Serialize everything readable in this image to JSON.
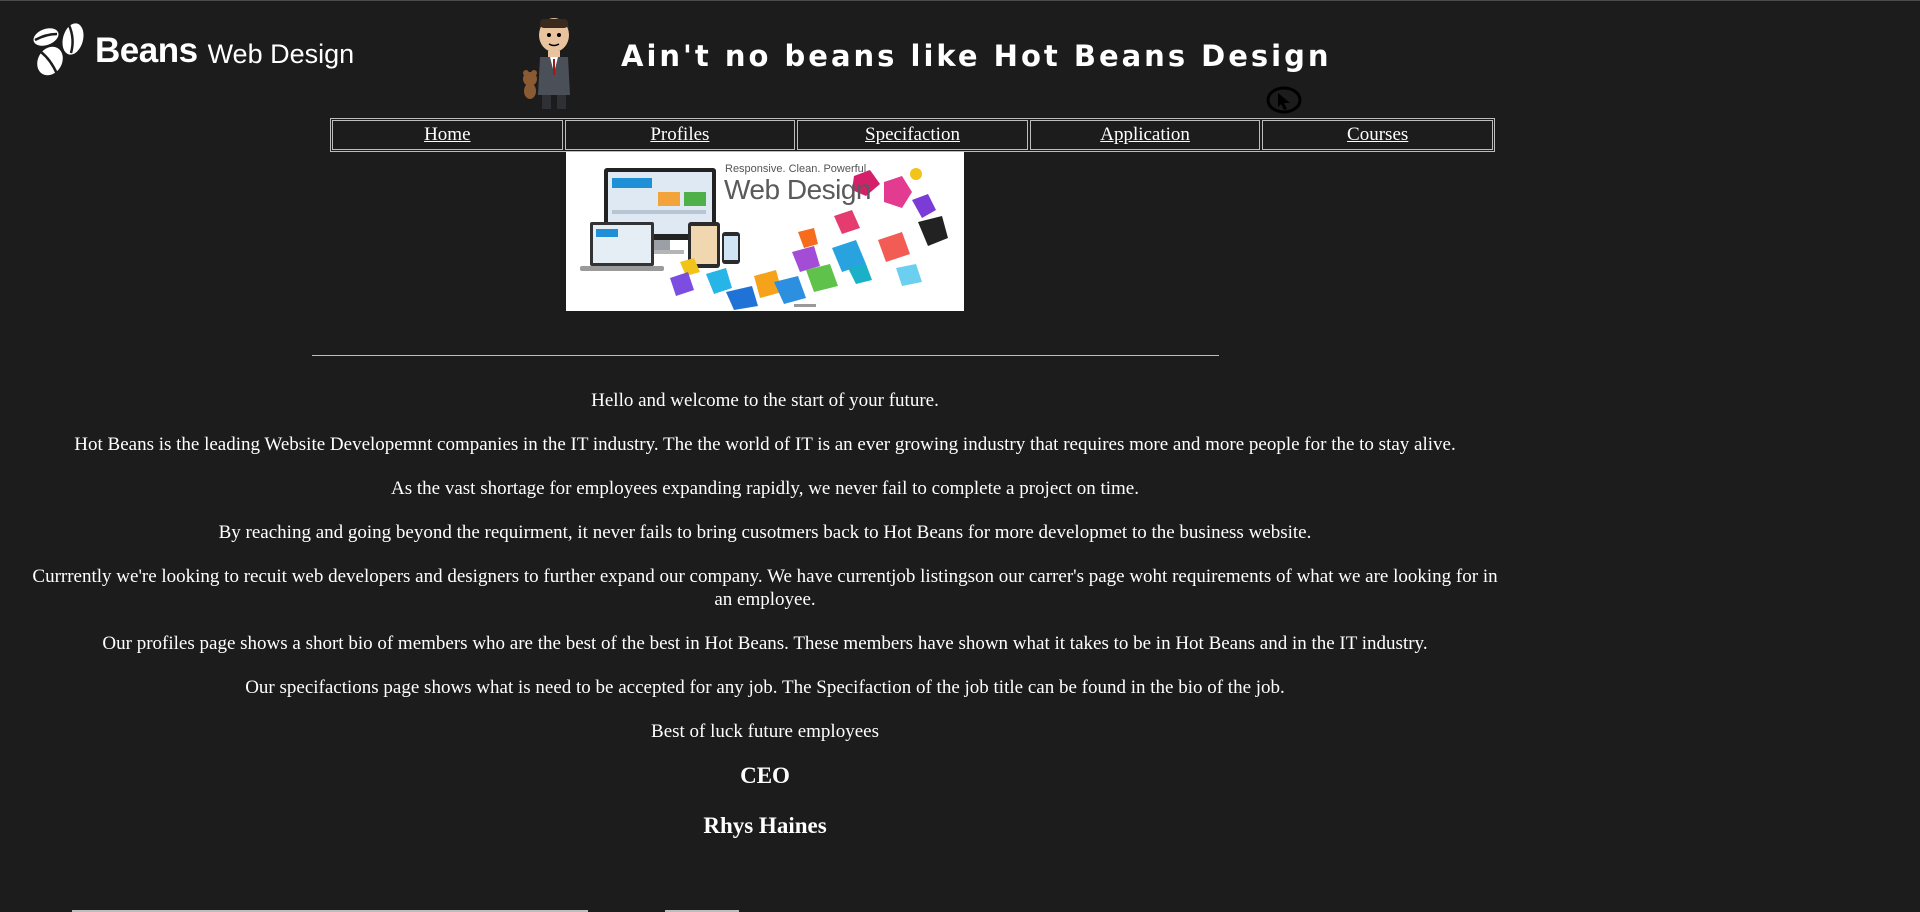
{
  "header": {
    "logo_bold": "Beans",
    "logo_light": "Web Design",
    "tagline": "Ain't no beans like Hot Beans Design"
  },
  "nav": {
    "items": [
      {
        "label": "Home"
      },
      {
        "label": "Profiles"
      },
      {
        "label": "Specifaction"
      },
      {
        "label": "Application"
      },
      {
        "label": "Courses"
      }
    ]
  },
  "banner": {
    "small_text": "Responsive. Clean. Powerful.",
    "big_text": "Web Design"
  },
  "main": {
    "paragraphs": [
      "Hello and welcome to the start of your future.",
      "Hot Beans is the leading Website Developemnt companies in the IT industry. The the world of IT is an ever growing industry that requires more and more people for the to stay alive.",
      "As the vast shortage for employees expanding rapidly, we never fail to complete a project on time.",
      "By reaching and going beyond the requirment, it never fails to bring cusotmers back to Hot Beans for more developmet to the business website.",
      "Currrently we're looking to recuit web developers and designers to further expand our company. We have currentjob listingson our carrer's page woht requirements of what we are looking for in an employee.",
      "Our profiles page shows a short bio of members who are the best of the best in Hot Beans. These members have shown what it takes to be in Hot Beans and in the IT industry.",
      "Our specifactions page shows what is need to be accepted for any job. The Specifaction of the job title can be found in the bio of the job.",
      "Best of luck future employees"
    ],
    "signature_title": "CEO",
    "signature_name": "Rhys Haines"
  },
  "colors": {
    "background": "#1c1c1c",
    "text": "#ffffff",
    "border": "#bdbdbd"
  }
}
